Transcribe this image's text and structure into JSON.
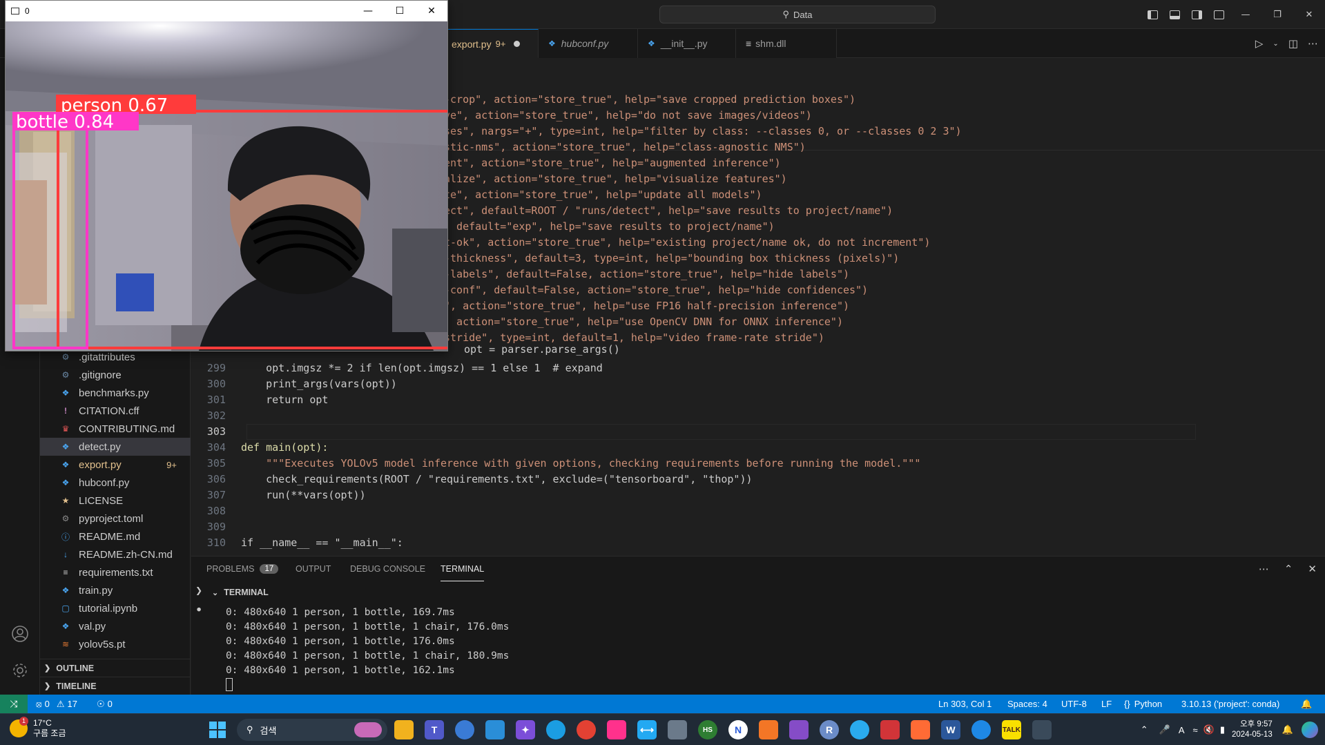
{
  "titlebar": {
    "command_center": "Data",
    "window_controls": [
      "minimize",
      "restore",
      "close"
    ]
  },
  "tabs": [
    {
      "label": "export.py",
      "badge": "9+",
      "active": true,
      "modified": true
    },
    {
      "label": "hubconf.py",
      "italic": true
    },
    {
      "label": "__init__.py"
    },
    {
      "label": "shm.dll",
      "icon": "lines-icon"
    }
  ],
  "explorer": {
    "files": [
      {
        "name": ".gitattributes",
        "icon": "gear-icon",
        "color": "#6b8aa8"
      },
      {
        "name": ".gitignore",
        "icon": "gear-icon",
        "color": "#6b8aa8"
      },
      {
        "name": "benchmarks.py",
        "icon": "python-icon",
        "color": "#4aa5f0"
      },
      {
        "name": "CITATION.cff",
        "icon": "exclamation-icon",
        "color": "#c586c0"
      },
      {
        "name": "CONTRIBUTING.md",
        "icon": "contributing-icon",
        "color": "#e05555"
      },
      {
        "name": "detect.py",
        "icon": "python-icon",
        "color": "#4aa5f0",
        "selected": true
      },
      {
        "name": "export.py",
        "icon": "python-icon",
        "color": "#4aa5f0",
        "modified": true,
        "badge": "9+"
      },
      {
        "name": "hubconf.py",
        "icon": "python-icon",
        "color": "#4aa5f0"
      },
      {
        "name": "LICENSE",
        "icon": "license-icon",
        "color": "#e2c08d"
      },
      {
        "name": "pyproject.toml",
        "icon": "gear-icon",
        "color": "#8a8a8a"
      },
      {
        "name": "README.md",
        "icon": "info-icon",
        "color": "#4aa5f0"
      },
      {
        "name": "README.zh-CN.md",
        "icon": "markdown-icon",
        "color": "#4aa5f0"
      },
      {
        "name": "requirements.txt",
        "icon": "lines-icon",
        "color": "#cccccc"
      },
      {
        "name": "train.py",
        "icon": "python-icon",
        "color": "#4aa5f0"
      },
      {
        "name": "tutorial.ipynb",
        "icon": "notebook-icon",
        "color": "#4aa5f0"
      },
      {
        "name": "val.py",
        "icon": "python-icon",
        "color": "#4aa5f0"
      },
      {
        "name": "yolov5s.pt",
        "icon": "rss-icon",
        "color": "#e37933"
      }
    ],
    "sections": [
      "OUTLINE",
      "TIMELINE"
    ]
  },
  "editor": {
    "partial_lines": [
      "-crop\", action=\"store_true\", help=\"save cropped prediction boxes\")",
      "ve\", action=\"store_true\", help=\"do not save images/videos\")",
      "ses\", nargs=\"+\", type=int, help=\"filter by class: --classes 0, or --classes 0 2 3\")",
      "stic-nms\", action=\"store_true\", help=\"class-agnostic NMS\")",
      "ent\", action=\"store_true\", help=\"augmented inference\")",
      "alize\", action=\"store_true\", help=\"visualize features\")",
      "te\", action=\"store_true\", help=\"update all models\")",
      "ect\", default=ROOT / \"runs/detect\", help=\"save results to project/name\")",
      ", default=\"exp\", help=\"save results to project/name\")",
      "t-ok\", action=\"store_true\", help=\"existing project/name ok, do not increment\")",
      "-thickness\", default=3, type=int, help=\"bounding box thickness (pixels)\")",
      "-labels\", default=False, action=\"store_true\", help=\"hide labels\")",
      "-conf\", default=False, action=\"store_true\", help=\"hide confidences\")",
      "\", action=\"store_true\", help=\"use FP16 half-precision inference\")",
      ", action=\"store_true\", help=\"use OpenCV DNN for ONNX inference\")",
      "stride\", type=int, default=1, help=\"video frame-rate stride\")",
      "opt = parser.parse_args()"
    ],
    "lines": [
      {
        "num": "299",
        "text": "    opt.imgsz *= 2 if len(opt.imgsz) == 1 else 1  # expand"
      },
      {
        "num": "300",
        "text": "    print_args(vars(opt))"
      },
      {
        "num": "301",
        "text": "    return opt"
      },
      {
        "num": "302",
        "text": ""
      },
      {
        "num": "303",
        "text": ""
      },
      {
        "num": "304",
        "text": "def main(opt):"
      },
      {
        "num": "305",
        "text": "    \"\"\"Executes YOLOv5 model inference with given options, checking requirements before running the model.\"\"\""
      },
      {
        "num": "306",
        "text": "    check_requirements(ROOT / \"requirements.txt\", exclude=(\"tensorboard\", \"thop\"))"
      },
      {
        "num": "307",
        "text": "    run(**vars(opt))"
      },
      {
        "num": "308",
        "text": ""
      },
      {
        "num": "309",
        "text": ""
      },
      {
        "num": "310",
        "text": "if __name__ == \"__main__\":"
      }
    ]
  },
  "panel": {
    "tabs": [
      {
        "label": "PROBLEMS",
        "count": "17"
      },
      {
        "label": "OUTPUT"
      },
      {
        "label": "DEBUG CONSOLE"
      },
      {
        "label": "TERMINAL",
        "active": true
      }
    ],
    "terminal_title": "TERMINAL",
    "terminal_lines": [
      "0: 480x640 1 person, 1 bottle, 169.7ms",
      "0: 480x640 1 person, 1 bottle, 1 chair, 176.0ms",
      "0: 480x640 1 person, 1 bottle, 176.0ms",
      "0: 480x640 1 person, 1 bottle, 1 chair, 180.9ms",
      "0: 480x640 1 person, 1 bottle, 162.1ms"
    ]
  },
  "statusbar": {
    "errors": "0",
    "warnings": "17",
    "ports": "0",
    "position": "Ln 303, Col 1",
    "spaces": "Spaces: 4",
    "encoding": "UTF-8",
    "eol": "LF",
    "language": "Python",
    "interpreter": "3.10.13 ('project': conda)"
  },
  "taskbar": {
    "weather_temp": "17°C",
    "weather_desc": "구름 조금",
    "weather_badge": "1",
    "search_placeholder": "검색",
    "clock_time": "오후 9:57",
    "clock_date": "2024-05-13"
  },
  "detection_window": {
    "title": "0",
    "detections": [
      {
        "label": "person",
        "confidence": "0.67",
        "color": "#ff3b3b"
      },
      {
        "label": "bottle",
        "confidence": "0.84",
        "color": "#ff37c7"
      }
    ]
  },
  "colors": {
    "accent": "#0078d4",
    "status_remote": "#16825d",
    "modified": "#e2c08d"
  }
}
